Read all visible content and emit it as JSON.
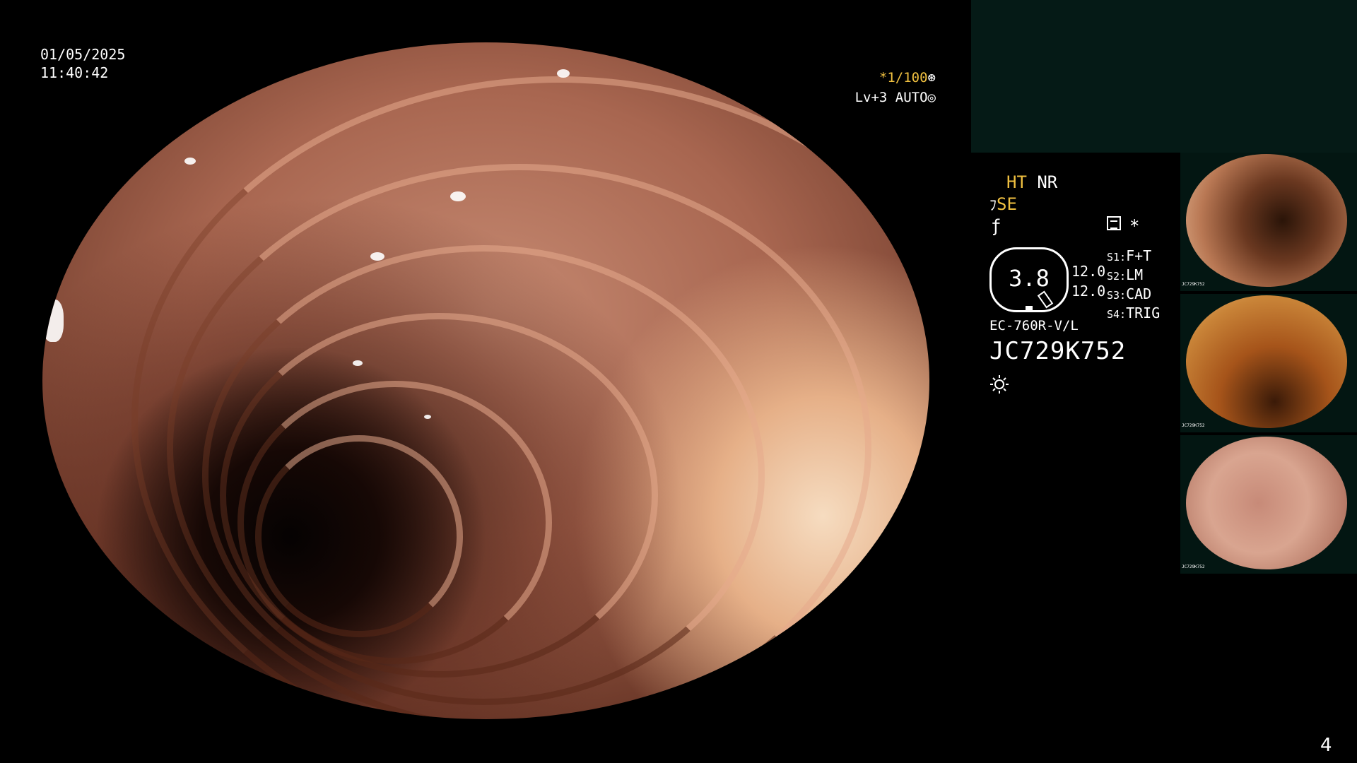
{
  "overlay": {
    "date": "01/05/2025",
    "time": "11:40:42",
    "shutter": "*1/100",
    "shutter_icon": "aperture-icon",
    "level": "Lv+3 AUTO",
    "level_icon": "auto-iris-icon"
  },
  "panel": {
    "mode_ht": "HT",
    "mode_nr": "NR",
    "mode_se": "SE",
    "star": "*",
    "dial_value": "3.8",
    "values": [
      "12.0",
      "12.0"
    ],
    "switches": [
      {
        "key": "S1:",
        "value": "F+T"
      },
      {
        "key": "S2:",
        "value": "LM"
      },
      {
        "key": "S3:",
        "value": "CAD"
      },
      {
        "key": "S4:",
        "value": "TRIG"
      }
    ],
    "scope_model": "EC-760R-V/L",
    "serial": "JC729K752"
  },
  "thumbnails": [
    {
      "label": "JC729K752"
    },
    {
      "label": "JC729K752"
    },
    {
      "label": "JC729K752"
    }
  ],
  "page_number": "4",
  "colors": {
    "accent_yellow": "#f0c040",
    "panel_bg": "#051a16"
  }
}
